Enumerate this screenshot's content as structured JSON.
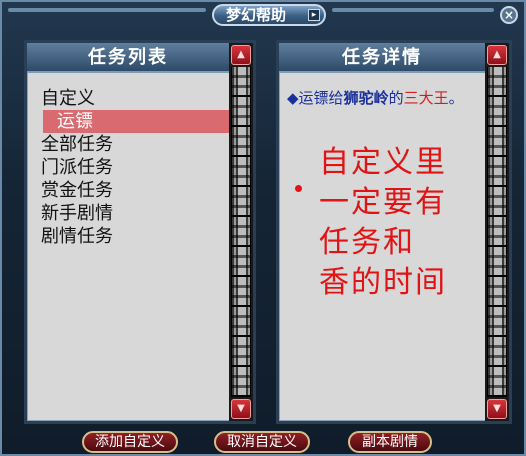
{
  "window": {
    "title": "梦幻帮助",
    "title_arrow": "▸",
    "close_glyph": "×"
  },
  "left_panel": {
    "header": "任务列表",
    "items": [
      "自定义",
      "运镖",
      "全部任务",
      "门派任务",
      "赏金任务",
      "新手剧情",
      "剧情任务"
    ],
    "selected_index": 1
  },
  "right_panel": {
    "header": "任务详情",
    "detail": {
      "bullet": "◆",
      "prefix": "运镖给",
      "npc": "狮驼岭",
      "mid": "的",
      "target": "三大王",
      "suffix": "。"
    },
    "annotation": [
      "自定义里",
      "一定要有",
      "任务和",
      "香的时间"
    ]
  },
  "buttons": {
    "add_custom": "添加自定义",
    "cancel_custom": "取消自定义",
    "instance_story": "副本剧情"
  },
  "scroll": {
    "up": "▲",
    "down": "▼"
  },
  "colors": {
    "panel_bg": "#d8d8d8",
    "header_bg": "#2e4a68",
    "selection": "#d86a70",
    "annotation": "#e01414",
    "link_blue": "#1a2f9a"
  }
}
